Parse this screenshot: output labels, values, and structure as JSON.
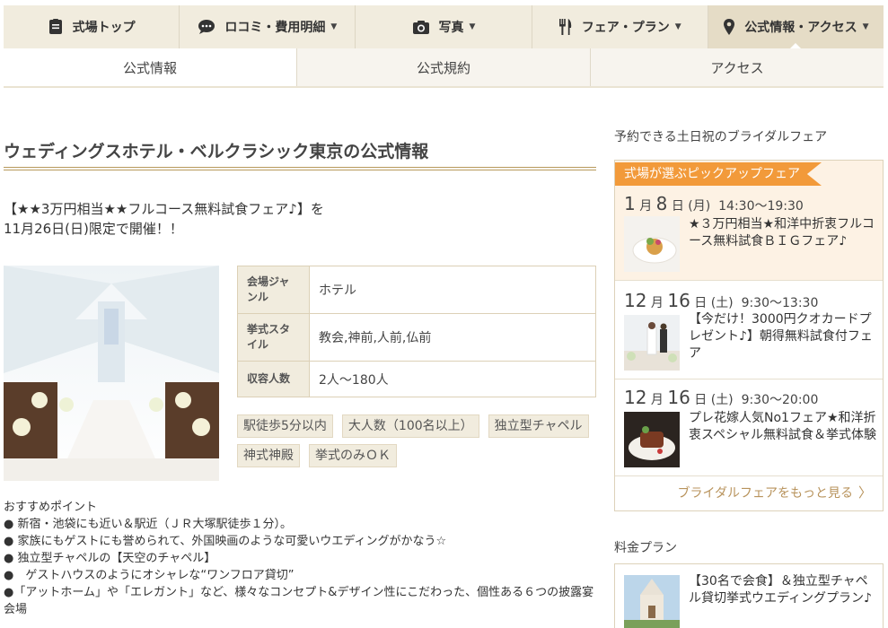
{
  "nav": {
    "tabs": [
      {
        "label": "式場トップ",
        "icon": "list-icon"
      },
      {
        "label": "ロコミ・費用明細",
        "icon": "chat-icon"
      },
      {
        "label": "写真",
        "icon": "camera-icon"
      },
      {
        "label": "フェア・プラン",
        "icon": "fork-knife-icon"
      },
      {
        "label": "公式情報・アクセス",
        "icon": "map-pin-icon"
      }
    ],
    "caret": "▼",
    "subtabs": [
      "公式情報",
      "公式規約",
      "アクセス"
    ]
  },
  "main": {
    "title": "ウェディングスホテル・ベルクラシック東京の公式情報",
    "lead_line1": "【★★3万円相当★★フルコース無料試食フェア♪】を",
    "lead_line2": "11月26日(日)限定で開催！！",
    "info": [
      {
        "key": "会場ジャンル",
        "value": "ホテル"
      },
      {
        "key": "挙式スタイル",
        "value": "教会,神前,人前,仏前"
      },
      {
        "key": "収容人数",
        "value": "2人～180人"
      }
    ],
    "tags": [
      "駅徒歩5分以内",
      "大人数（100名以上）",
      "独立型チャペル",
      "神式神殿",
      "挙式のみＯＫ"
    ],
    "points_heading": "おすすめポイント",
    "points": [
      "● 新宿・池袋にも近い＆駅近（ＪＲ大塚駅徒歩１分）。",
      "● 家族にもゲストにも誉められて、外国映画のような可愛いウエディングがかなう☆",
      "● 独立型チャペルの【天空のチャペル】",
      "●　ゲストハウスのようにオシャレな“ワンフロア貸切”",
      "●「アットホーム」や「エレガント」など、様々なコンセプト&デザイン性にこだわった、個性ある６つの披露宴会場"
    ]
  },
  "sidebar": {
    "fair_heading": "予約できる土日祝のブライダルフェア",
    "pick_label": "式場が選ぶピックアップフェア",
    "fairs": [
      {
        "month": "1",
        "day": "8",
        "weekday": "(月)",
        "time": "14:30～19:30",
        "title": "★３万円相当★和洋中折衷フルコース無料試食ＢＩＧフェア♪"
      },
      {
        "month": "12",
        "day": "16",
        "weekday": "(土)",
        "time": "9:30～13:30",
        "title": "【今だけ！3000円クオカードプレゼント♪】朝得無料試食付フェア"
      },
      {
        "month": "12",
        "day": "16",
        "weekday": "(土)",
        "time": "9:30～20:00",
        "title": "プレ花嫁人気No1フェア★和洋折衷スペシャル無料試食＆挙式体験"
      }
    ],
    "month_unit": "月",
    "day_unit": "日",
    "more_label": "ブライダルフェアをもっと見る",
    "plan_heading": "料金プラン",
    "plan_title": "【30名で会食】＆独立型チャペル貸切挙式ウエディングプラン♪"
  },
  "colors": {
    "accent": "#f29a3a",
    "beige": "#f1ecde",
    "gold": "#b89a5c"
  }
}
